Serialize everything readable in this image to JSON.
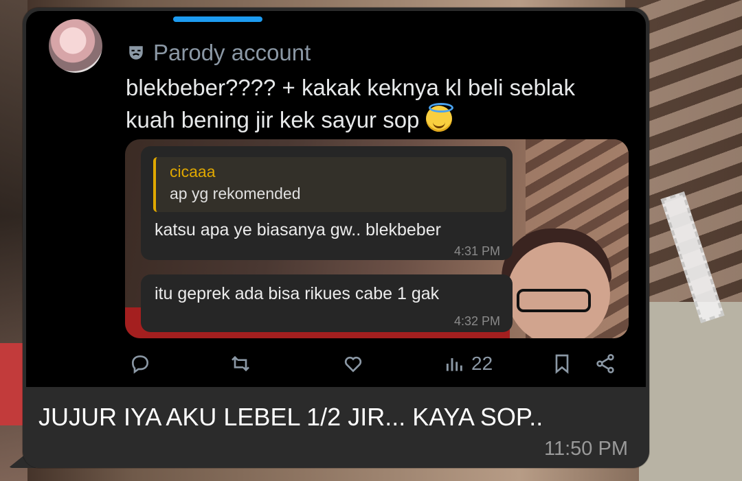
{
  "tweet": {
    "badge_label": "Parody account",
    "text_lines": [
      "blekbeber???? + kakak keknya kl beli seblak",
      "kuah bening jir kek sayur sop"
    ],
    "emoji": "smiling-face-with-halo",
    "views_count": "22"
  },
  "embedded_chat": {
    "message1": {
      "quoted_name": "cicaaa",
      "quoted_text": "ap yg rekomended",
      "text": "katsu apa ye biasanya gw.. blekbeber",
      "time": "4:31 PM"
    },
    "message2": {
      "text": "itu geprek ada bisa rikues cabe 1 gak",
      "time": "4:32 PM"
    }
  },
  "message": {
    "caption": "JUJUR IYA AKU LEBEL 1/2 JIR... KAYA SOP..",
    "time": "11:50 PM"
  },
  "colors": {
    "bubble": "#2b2b2b",
    "tweet_bg": "#000000",
    "muted_icon": "#8b98a5",
    "quote_accent": "#e0a800",
    "scroll_accent": "#1d9bf0"
  }
}
